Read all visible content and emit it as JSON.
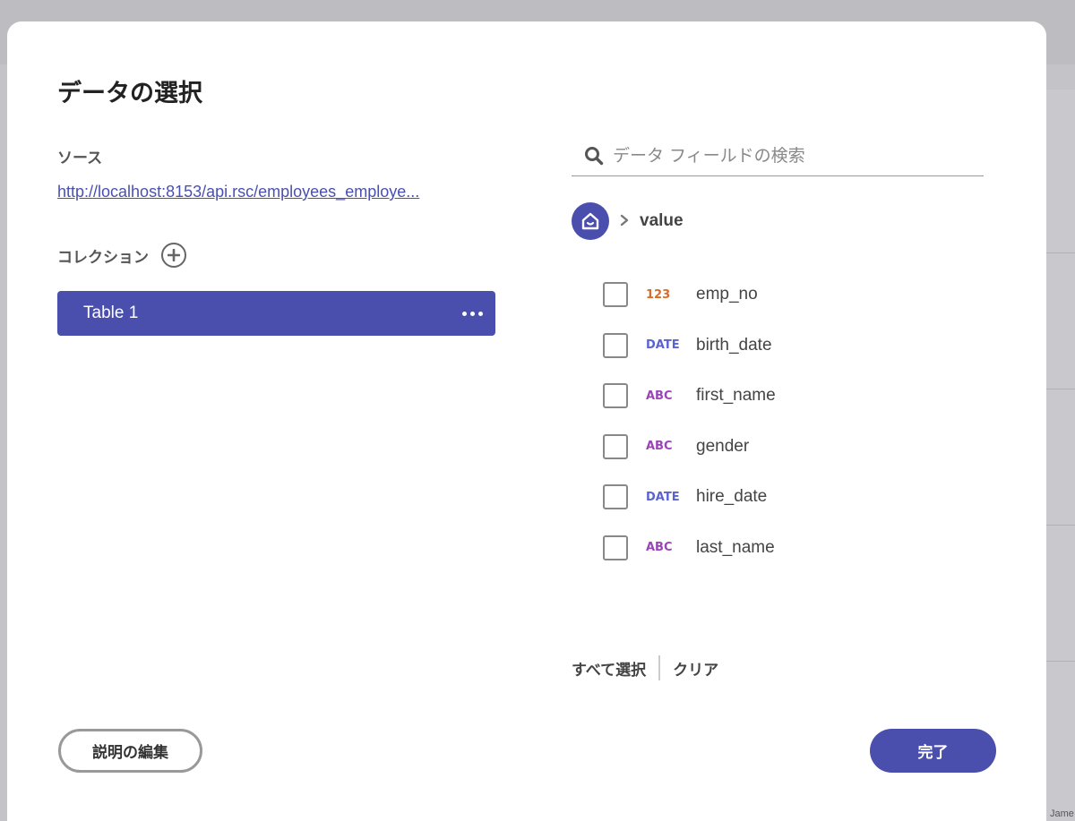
{
  "background": {
    "bottom_label": "Jame"
  },
  "dialog": {
    "title": "データの選択",
    "source_label": "ソース",
    "source_url": "http://localhost:8153/api.rsc/employees_employe...",
    "collection_label": "コレクション",
    "collections": [
      {
        "label": "Table 1",
        "selected": true
      }
    ],
    "search": {
      "placeholder": "データ フィールドの検索",
      "value": ""
    },
    "breadcrumb": {
      "home_icon": "home-icon",
      "current": "value"
    },
    "fields": [
      {
        "type": "123",
        "type_kind": "number",
        "name": "emp_no",
        "checked": false
      },
      {
        "type": "DATE",
        "type_kind": "date",
        "name": "birth_date",
        "checked": false
      },
      {
        "type": "ABC",
        "type_kind": "text",
        "name": "first_name",
        "checked": false
      },
      {
        "type": "ABC",
        "type_kind": "text",
        "name": "gender",
        "checked": false
      },
      {
        "type": "DATE",
        "type_kind": "date",
        "name": "hire_date",
        "checked": false
      },
      {
        "type": "ABC",
        "type_kind": "text",
        "name": "last_name",
        "checked": false
      }
    ],
    "select_all_label": "すべて選択",
    "clear_label": "クリア",
    "edit_description_label": "説明の編集",
    "done_label": "完了"
  },
  "colors": {
    "accent": "#4a4fae",
    "type_number": "#d86b2a",
    "type_date": "#5b63d3",
    "type_text": "#9b44b8",
    "link": "#4a50b0"
  }
}
